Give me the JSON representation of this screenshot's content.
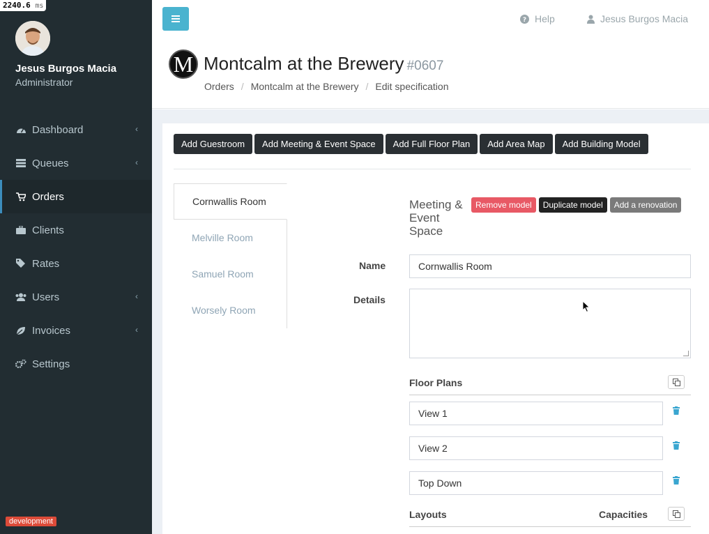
{
  "timer": {
    "value": "2240.6",
    "unit": "ms"
  },
  "user": {
    "name": "Jesus Burgos Macia",
    "role": "Administrator"
  },
  "nav": [
    {
      "label": "Dashboard",
      "icon": "dashboard-icon",
      "has_children": true
    },
    {
      "label": "Queues",
      "icon": "list-icon",
      "has_children": true
    },
    {
      "label": "Orders",
      "icon": "cart-icon",
      "has_children": false,
      "active": true
    },
    {
      "label": "Clients",
      "icon": "briefcase-icon",
      "has_children": false
    },
    {
      "label": "Rates",
      "icon": "tags-icon",
      "has_children": false
    },
    {
      "label": "Users",
      "icon": "users-icon",
      "has_children": true
    },
    {
      "label": "Invoices",
      "icon": "leaf-icon",
      "has_children": true
    },
    {
      "label": "Settings",
      "icon": "cogs-icon",
      "has_children": false
    }
  ],
  "env_badge": "development",
  "topbar": {
    "help": "Help",
    "user": "Jesus Burgos Macia"
  },
  "header": {
    "logo_letter": "M",
    "title": "Montcalm at the Brewery",
    "code": "#0607",
    "breadcrumbs": [
      "Orders",
      "Montcalm at the Brewery",
      "Edit specification"
    ]
  },
  "actions": [
    "Add Guestroom",
    "Add Meeting & Event Space",
    "Add Full Floor Plan",
    "Add Area Map",
    "Add Building Model"
  ],
  "rooms": [
    "Cornwallis Room",
    "Melville Room",
    "Samuel Room",
    "Worsely Room"
  ],
  "panel": {
    "title_lines": [
      "Meeting &",
      "Event",
      "Space"
    ],
    "remove": "Remove model",
    "duplicate": "Duplicate model",
    "renovation": "Add a renovation",
    "name_label": "Name",
    "name_value": "Cornwallis Room",
    "details_label": "Details",
    "details_value": "",
    "floor_plans_label": "Floor Plans",
    "floor_plans": [
      "View 1",
      "View 2",
      "Top Down"
    ],
    "layouts_label": "Layouts",
    "capacities_label": "Capacities"
  },
  "colors": {
    "sidebar": "#222d32",
    "accent": "#4ab3cf",
    "danger": "#e85965"
  }
}
